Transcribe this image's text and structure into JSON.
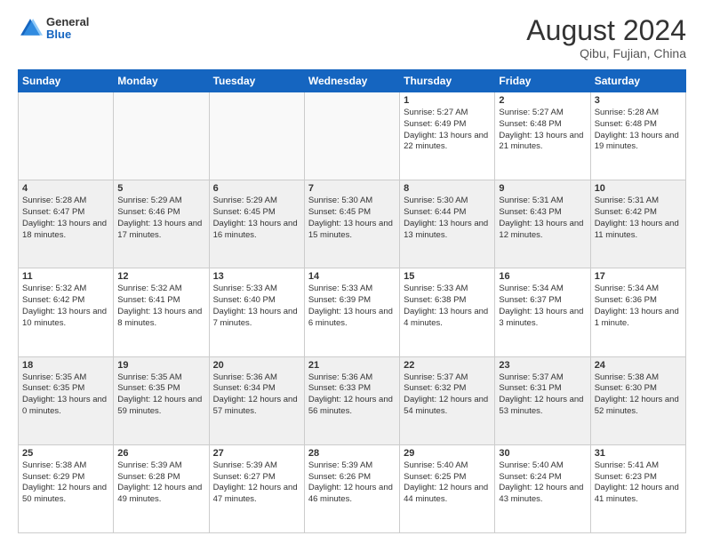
{
  "header": {
    "logo_general": "General",
    "logo_blue": "Blue",
    "month_year": "August 2024",
    "location": "Qibu, Fujian, China"
  },
  "weekdays": [
    "Sunday",
    "Monday",
    "Tuesday",
    "Wednesday",
    "Thursday",
    "Friday",
    "Saturday"
  ],
  "weeks": [
    [
      {
        "day": "",
        "detail": ""
      },
      {
        "day": "",
        "detail": ""
      },
      {
        "day": "",
        "detail": ""
      },
      {
        "day": "",
        "detail": ""
      },
      {
        "day": "1",
        "detail": "Sunrise: 5:27 AM\nSunset: 6:49 PM\nDaylight: 13 hours\nand 22 minutes."
      },
      {
        "day": "2",
        "detail": "Sunrise: 5:27 AM\nSunset: 6:48 PM\nDaylight: 13 hours\nand 21 minutes."
      },
      {
        "day": "3",
        "detail": "Sunrise: 5:28 AM\nSunset: 6:48 PM\nDaylight: 13 hours\nand 19 minutes."
      }
    ],
    [
      {
        "day": "4",
        "detail": "Sunrise: 5:28 AM\nSunset: 6:47 PM\nDaylight: 13 hours\nand 18 minutes."
      },
      {
        "day": "5",
        "detail": "Sunrise: 5:29 AM\nSunset: 6:46 PM\nDaylight: 13 hours\nand 17 minutes."
      },
      {
        "day": "6",
        "detail": "Sunrise: 5:29 AM\nSunset: 6:45 PM\nDaylight: 13 hours\nand 16 minutes."
      },
      {
        "day": "7",
        "detail": "Sunrise: 5:30 AM\nSunset: 6:45 PM\nDaylight: 13 hours\nand 15 minutes."
      },
      {
        "day": "8",
        "detail": "Sunrise: 5:30 AM\nSunset: 6:44 PM\nDaylight: 13 hours\nand 13 minutes."
      },
      {
        "day": "9",
        "detail": "Sunrise: 5:31 AM\nSunset: 6:43 PM\nDaylight: 13 hours\nand 12 minutes."
      },
      {
        "day": "10",
        "detail": "Sunrise: 5:31 AM\nSunset: 6:42 PM\nDaylight: 13 hours\nand 11 minutes."
      }
    ],
    [
      {
        "day": "11",
        "detail": "Sunrise: 5:32 AM\nSunset: 6:42 PM\nDaylight: 13 hours\nand 10 minutes."
      },
      {
        "day": "12",
        "detail": "Sunrise: 5:32 AM\nSunset: 6:41 PM\nDaylight: 13 hours\nand 8 minutes."
      },
      {
        "day": "13",
        "detail": "Sunrise: 5:33 AM\nSunset: 6:40 PM\nDaylight: 13 hours\nand 7 minutes."
      },
      {
        "day": "14",
        "detail": "Sunrise: 5:33 AM\nSunset: 6:39 PM\nDaylight: 13 hours\nand 6 minutes."
      },
      {
        "day": "15",
        "detail": "Sunrise: 5:33 AM\nSunset: 6:38 PM\nDaylight: 13 hours\nand 4 minutes."
      },
      {
        "day": "16",
        "detail": "Sunrise: 5:34 AM\nSunset: 6:37 PM\nDaylight: 13 hours\nand 3 minutes."
      },
      {
        "day": "17",
        "detail": "Sunrise: 5:34 AM\nSunset: 6:36 PM\nDaylight: 13 hours\nand 1 minute."
      }
    ],
    [
      {
        "day": "18",
        "detail": "Sunrise: 5:35 AM\nSunset: 6:35 PM\nDaylight: 13 hours\nand 0 minutes."
      },
      {
        "day": "19",
        "detail": "Sunrise: 5:35 AM\nSunset: 6:35 PM\nDaylight: 12 hours\nand 59 minutes."
      },
      {
        "day": "20",
        "detail": "Sunrise: 5:36 AM\nSunset: 6:34 PM\nDaylight: 12 hours\nand 57 minutes."
      },
      {
        "day": "21",
        "detail": "Sunrise: 5:36 AM\nSunset: 6:33 PM\nDaylight: 12 hours\nand 56 minutes."
      },
      {
        "day": "22",
        "detail": "Sunrise: 5:37 AM\nSunset: 6:32 PM\nDaylight: 12 hours\nand 54 minutes."
      },
      {
        "day": "23",
        "detail": "Sunrise: 5:37 AM\nSunset: 6:31 PM\nDaylight: 12 hours\nand 53 minutes."
      },
      {
        "day": "24",
        "detail": "Sunrise: 5:38 AM\nSunset: 6:30 PM\nDaylight: 12 hours\nand 52 minutes."
      }
    ],
    [
      {
        "day": "25",
        "detail": "Sunrise: 5:38 AM\nSunset: 6:29 PM\nDaylight: 12 hours\nand 50 minutes."
      },
      {
        "day": "26",
        "detail": "Sunrise: 5:39 AM\nSunset: 6:28 PM\nDaylight: 12 hours\nand 49 minutes."
      },
      {
        "day": "27",
        "detail": "Sunrise: 5:39 AM\nSunset: 6:27 PM\nDaylight: 12 hours\nand 47 minutes."
      },
      {
        "day": "28",
        "detail": "Sunrise: 5:39 AM\nSunset: 6:26 PM\nDaylight: 12 hours\nand 46 minutes."
      },
      {
        "day": "29",
        "detail": "Sunrise: 5:40 AM\nSunset: 6:25 PM\nDaylight: 12 hours\nand 44 minutes."
      },
      {
        "day": "30",
        "detail": "Sunrise: 5:40 AM\nSunset: 6:24 PM\nDaylight: 12 hours\nand 43 minutes."
      },
      {
        "day": "31",
        "detail": "Sunrise: 5:41 AM\nSunset: 6:23 PM\nDaylight: 12 hours\nand 41 minutes."
      }
    ]
  ]
}
